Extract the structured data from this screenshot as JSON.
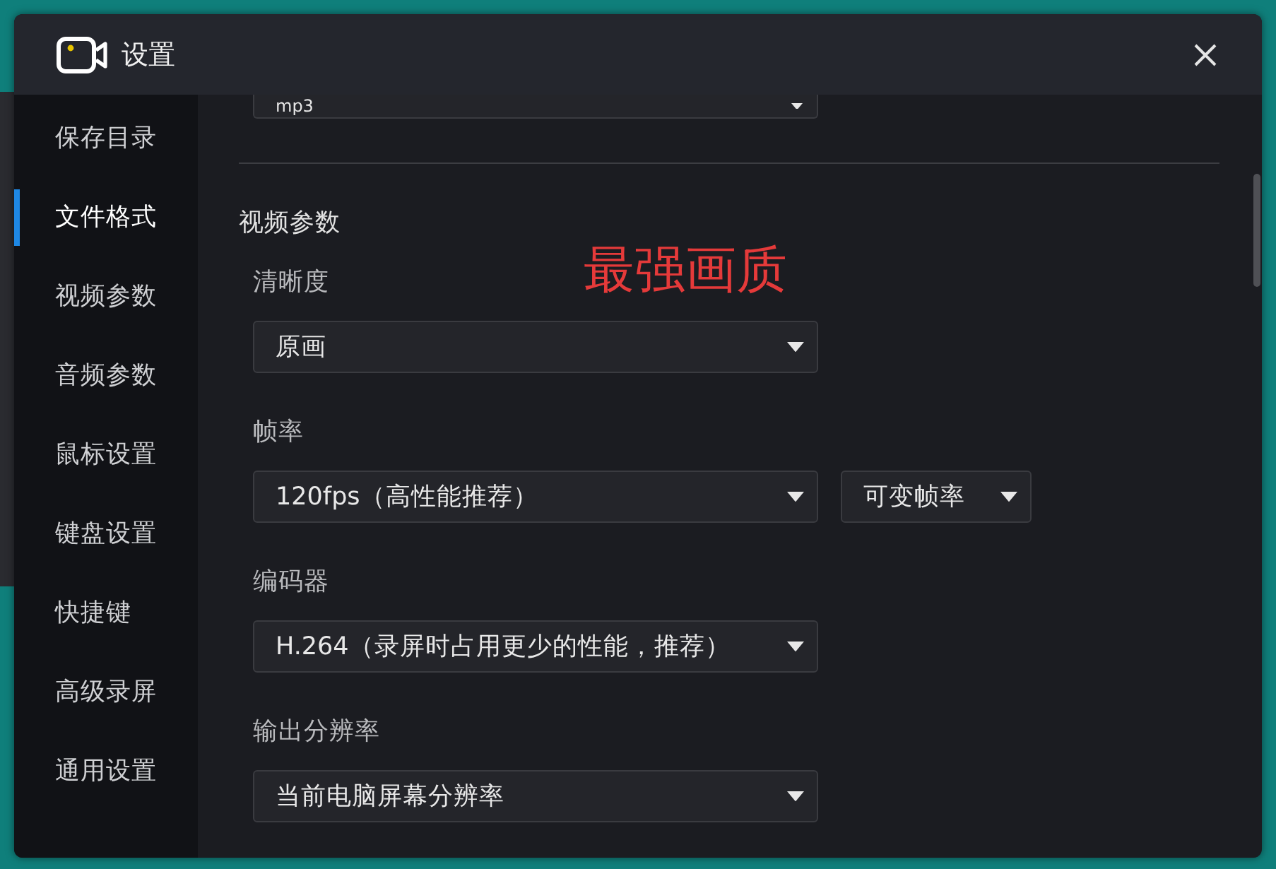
{
  "window": {
    "title": "设置"
  },
  "sidebar": {
    "items": [
      {
        "label": "保存目录",
        "selected": false
      },
      {
        "label": "文件格式",
        "selected": true
      },
      {
        "label": "视频参数",
        "selected": false
      },
      {
        "label": "音频参数",
        "selected": false
      },
      {
        "label": "鼠标设置",
        "selected": false
      },
      {
        "label": "键盘设置",
        "selected": false
      },
      {
        "label": "快捷键",
        "selected": false
      },
      {
        "label": "高级录屏",
        "selected": false
      },
      {
        "label": "通用设置",
        "selected": false
      }
    ]
  },
  "content": {
    "top_dropdown": {
      "value": "mp3"
    },
    "section": {
      "title": "视频参数",
      "annotation": "最强画质",
      "fields": [
        {
          "label": "清晰度",
          "dropdowns": [
            {
              "value": "原画"
            }
          ]
        },
        {
          "label": "帧率",
          "dropdowns": [
            {
              "value": "120fps（高性能推荐）"
            },
            {
              "value": "可变帧率"
            }
          ]
        },
        {
          "label": "编码器",
          "dropdowns": [
            {
              "value": "H.264（录屏时占用更少的性能，推荐）"
            }
          ]
        },
        {
          "label": "输出分辨率",
          "dropdowns": [
            {
              "value": "当前电脑屏幕分辨率"
            }
          ]
        }
      ]
    }
  }
}
